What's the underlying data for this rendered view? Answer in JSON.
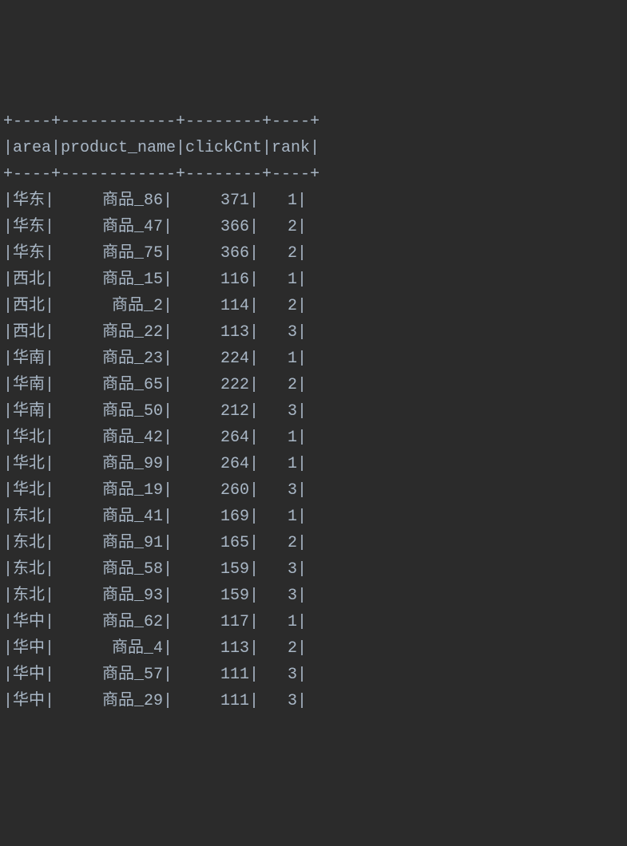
{
  "chart_data": {
    "type": "table",
    "columns": [
      "area",
      "product_name",
      "clickCnt",
      "rank"
    ],
    "rows": [
      {
        "area": "华东",
        "product_name": "商品_86",
        "clickCnt": 371,
        "rank": 1
      },
      {
        "area": "华东",
        "product_name": "商品_47",
        "clickCnt": 366,
        "rank": 2
      },
      {
        "area": "华东",
        "product_name": "商品_75",
        "clickCnt": 366,
        "rank": 2
      },
      {
        "area": "西北",
        "product_name": "商品_15",
        "clickCnt": 116,
        "rank": 1
      },
      {
        "area": "西北",
        "product_name": "商品_2",
        "clickCnt": 114,
        "rank": 2
      },
      {
        "area": "西北",
        "product_name": "商品_22",
        "clickCnt": 113,
        "rank": 3
      },
      {
        "area": "华南",
        "product_name": "商品_23",
        "clickCnt": 224,
        "rank": 1
      },
      {
        "area": "华南",
        "product_name": "商品_65",
        "clickCnt": 222,
        "rank": 2
      },
      {
        "area": "华南",
        "product_name": "商品_50",
        "clickCnt": 212,
        "rank": 3
      },
      {
        "area": "华北",
        "product_name": "商品_42",
        "clickCnt": 264,
        "rank": 1
      },
      {
        "area": "华北",
        "product_name": "商品_99",
        "clickCnt": 264,
        "rank": 1
      },
      {
        "area": "华北",
        "product_name": "商品_19",
        "clickCnt": 260,
        "rank": 3
      },
      {
        "area": "东北",
        "product_name": "商品_41",
        "clickCnt": 169,
        "rank": 1
      },
      {
        "area": "东北",
        "product_name": "商品_91",
        "clickCnt": 165,
        "rank": 2
      },
      {
        "area": "东北",
        "product_name": "商品_58",
        "clickCnt": 159,
        "rank": 3
      },
      {
        "area": "东北",
        "product_name": "商品_93",
        "clickCnt": 159,
        "rank": 3
      },
      {
        "area": "华中",
        "product_name": "商品_62",
        "clickCnt": 117,
        "rank": 1
      },
      {
        "area": "华中",
        "product_name": "商品_4",
        "clickCnt": 113,
        "rank": 2
      },
      {
        "area": "华中",
        "product_name": "商品_57",
        "clickCnt": 111,
        "rank": 3
      },
      {
        "area": "华中",
        "product_name": "商品_29",
        "clickCnt": 111,
        "rank": 3
      }
    ]
  },
  "col_widths": {
    "area": 4,
    "product_name": 12,
    "clickCnt": 8,
    "rank": 4
  },
  "border": "+----+------------+--------+----+"
}
